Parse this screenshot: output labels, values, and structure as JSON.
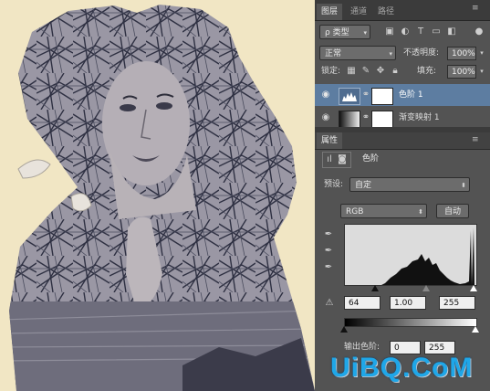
{
  "canvas": {
    "background": "#f1e6c4",
    "tint": "#4a4e66"
  },
  "layers_panel": {
    "tabs": [
      "图层",
      "通道",
      "路径"
    ],
    "filter_kind": "类型",
    "blend_mode": "正常",
    "opacity_label": "不透明度:",
    "opacity_value": "100%",
    "lock_label": "锁定:",
    "fill_label": "填充:",
    "fill_value": "100%",
    "layers": [
      {
        "name": "色阶 1",
        "selected": true
      },
      {
        "name": "渐变映射 1",
        "selected": false
      }
    ]
  },
  "properties_panel": {
    "title": "属性",
    "adjustment_name": "色阶",
    "preset_label": "预设:",
    "preset_value": "自定",
    "channel_value": "RGB",
    "auto_label": "自动",
    "input_black": "64",
    "input_gamma": "1.00",
    "input_white": "255",
    "output_label": "输出色阶:",
    "output_black": "0",
    "output_white": "255"
  },
  "watermark": "UiBQ.CoM",
  "colors": {
    "selection": "#5d7da1",
    "panel": "#535353",
    "tabbar": "#3b3b3b"
  }
}
